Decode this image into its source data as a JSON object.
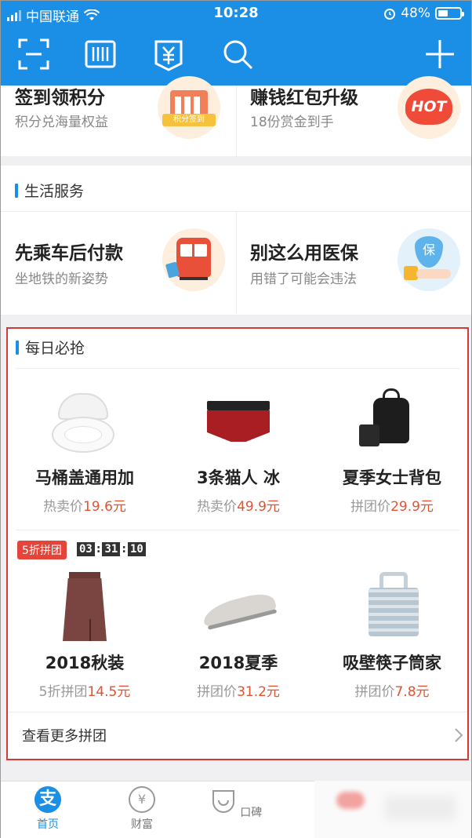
{
  "status_bar": {
    "carrier": "中国联通",
    "time": "10:28",
    "battery": "48%",
    "battery_level": 0.48
  },
  "toolbar_icons": [
    "scan-icon",
    "barcode-icon",
    "pay-code-icon",
    "search-icon",
    "plus-icon"
  ],
  "top_cards": [
    {
      "title": "签到领积分",
      "subtitle": "积分兑海量权益",
      "badge": "积分签到"
    },
    {
      "title": "赚钱红包升级",
      "subtitle": "18份赏金到手",
      "badge": "HOT"
    }
  ],
  "life_services": {
    "heading": "生活服务",
    "items": [
      {
        "title": "先乘车后付款",
        "subtitle": "坐地铁的新姿势",
        "icon": "train-icon"
      },
      {
        "title": "别这么用医保",
        "subtitle": "用错了可能会违法",
        "icon": "shield-hand-icon",
        "badge": "保"
      }
    ]
  },
  "daily": {
    "heading": "每日必抢",
    "row1": [
      {
        "name": "马桶盖通用加",
        "price_label": "热卖价",
        "price": "19.6元",
        "icon": "toilet-seat"
      },
      {
        "name": "3条猫人 冰",
        "price_label": "热卖价",
        "price": "49.9元",
        "icon": "underwear"
      },
      {
        "name": "夏季女士背包",
        "price_label": "拼团价",
        "price": "29.9元",
        "icon": "backpack"
      }
    ],
    "group_tag": "5折拼团",
    "timer": {
      "h": "03",
      "m": "31",
      "s": "10"
    },
    "row2": [
      {
        "name": "2018秋装",
        "price_label": "5折拼团",
        "price": "14.5元",
        "icon": "skirt"
      },
      {
        "name": "2018夏季",
        "price_label": "拼团价",
        "price": "31.2元",
        "icon": "shoe"
      },
      {
        "name": "吸壁筷子筒家",
        "price_label": "拼团价",
        "price": "7.8元",
        "icon": "chopstick-holder"
      }
    ],
    "more_label": "查看更多拼团"
  },
  "tabs": [
    {
      "label": "首页",
      "active": true
    },
    {
      "label": "财富",
      "active": false
    },
    {
      "label": "口碑",
      "active": false
    }
  ],
  "colors": {
    "brand": "#1b8ee6",
    "price": "#e5512f",
    "highlight_border": "#d23c34"
  }
}
